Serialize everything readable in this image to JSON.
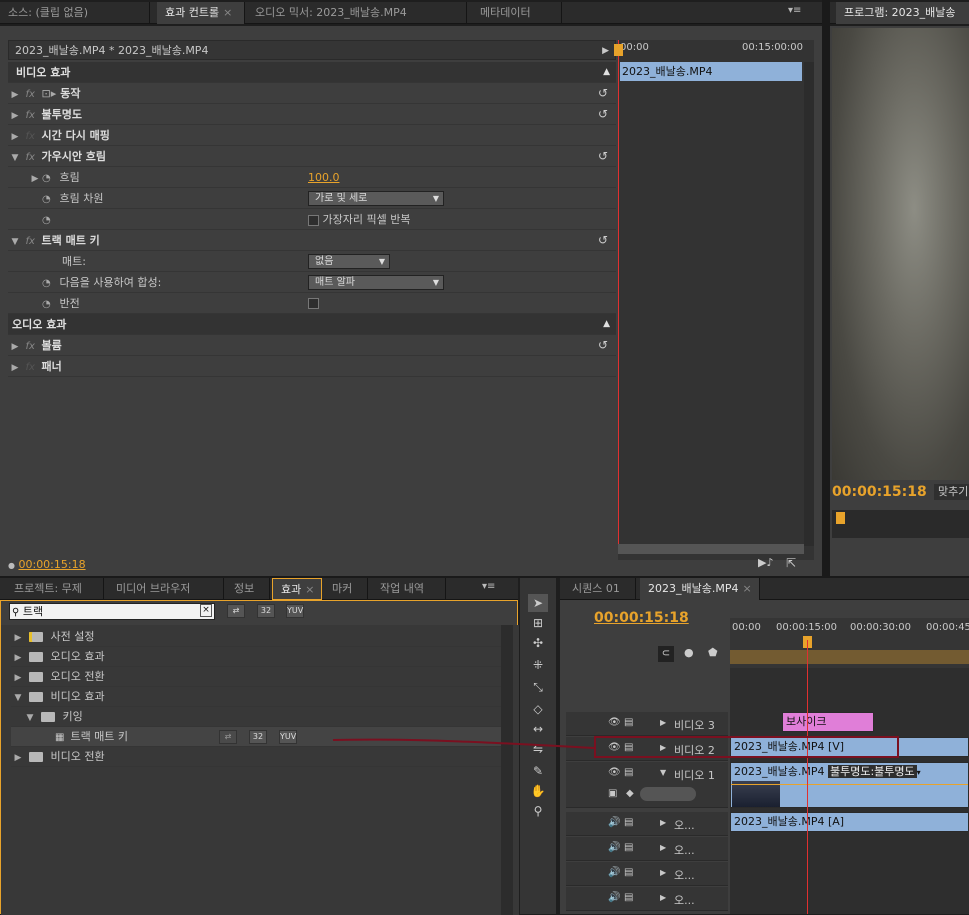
{
  "source_tabs": [
    "소스: (클립 없음)",
    "효과 컨트롤",
    "오디오 믹서: 2023_배날송.MP4",
    "메타데이터"
  ],
  "program_tab": "프로그램: 2023_배날송",
  "ec": {
    "clip_path": "2023_배날송.MP4 * 2023_배날송.MP4",
    "time_start": "00:00",
    "time_end": "00:15:00:00",
    "clip_bar": "2023_배날송.MP4",
    "video_effects": "비디오 효과",
    "motion": "동작",
    "opacity": "불투명도",
    "time_remap": "시간 다시 매핑",
    "gaussian": "가우시안 흐림",
    "blur": "흐림",
    "blur_value": "100.0",
    "blur_dim": "흐림 차원",
    "blur_dim_value": "가로 및 세로",
    "repeat_edge": "가장자리 픽셀 반복",
    "track_matte": "트랙 매트 키",
    "matte": "매트:",
    "matte_value": "없음",
    "composite": "다음을 사용하여 합성:",
    "composite_value": "매트 알파",
    "reverse": "반전",
    "audio_effects": "오디오 효과",
    "volume": "볼륨",
    "panner": "패너",
    "timecode": "00:00:15:18"
  },
  "program": {
    "timecode": "00:00:15:18",
    "fit": "맞추기"
  },
  "project_tabs": [
    "프로젝트: 무제",
    "미디어 브라우저",
    "정보",
    "효과",
    "마커",
    "작업 내역"
  ],
  "search": {
    "value": "트랙"
  },
  "tree": [
    "사전 설정",
    "오디오 효과",
    "오디오 전환",
    "비디오 효과",
    "키잉",
    "트랙 매트 키",
    "비디오 전환"
  ],
  "icons": {
    "b1": "32",
    "b2": "YUV"
  },
  "seq": {
    "tabs": [
      "시퀀스 01",
      "2023_배날송.MP4"
    ],
    "timecode": "00:00:15:18",
    "ruler": [
      "00:00",
      "00:00:15:00",
      "00:00:30:00",
      "00:00:45"
    ],
    "tracks": {
      "v3": "비디오 3",
      "v2": "비디오 2",
      "v1": "비디오 1",
      "a": "오..."
    },
    "clip_v3": "보사이크",
    "clip_v2": "2023_배날송.MP4 [V]",
    "clip_v1": "2023_배날송.MP4",
    "clip_v1_fx": "불투명도:불투명도",
    "clip_a1": "2023_배날송.MP4 [A]"
  },
  "colors": {
    "accent": "#e8a32b",
    "playhead": "#e03030",
    "clip_blue": "#8fb1d9",
    "clip_pink": "#e07ed8",
    "annotation": "#7a1020"
  }
}
